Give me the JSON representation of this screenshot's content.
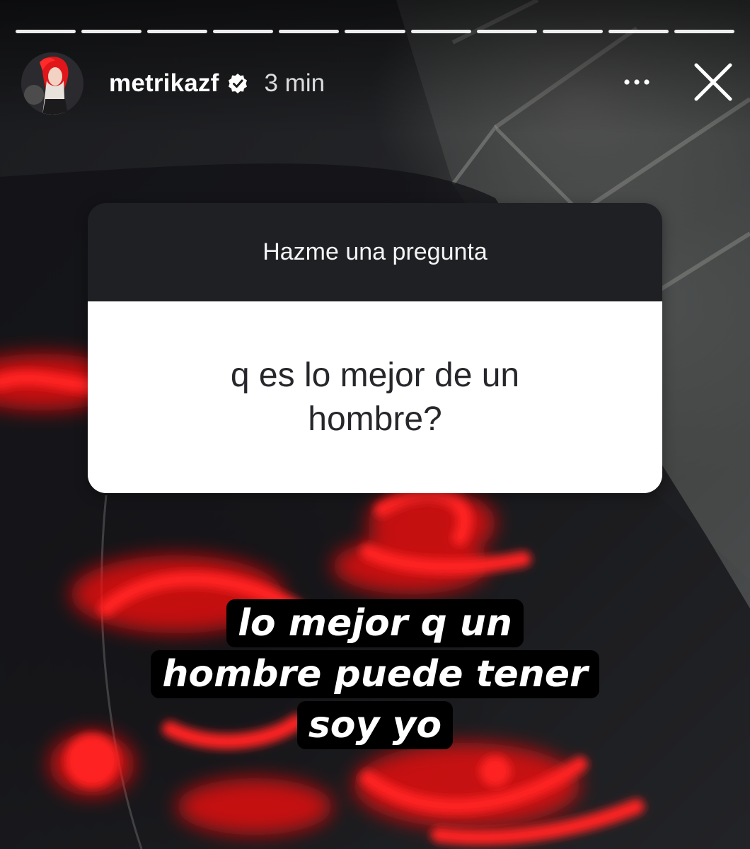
{
  "progress": {
    "segments": 11,
    "completed": 11
  },
  "header": {
    "username": "metrikazf",
    "verified": true,
    "time": "3 min",
    "avatar_icon": "avatar-red-hair",
    "more_icon": "more-horizontal-icon",
    "close_icon": "close-icon"
  },
  "question_sticker": {
    "title": "Hazme una pregunta",
    "question": "q es lo mejor de un hombre?"
  },
  "answer": {
    "lines": [
      "lo mejor q un",
      "hombre puede tener",
      "soy yo"
    ]
  },
  "colors": {
    "sticker_header": "#1e2024",
    "sticker_body": "#ffffff",
    "graffiti_red": "#ff1a1a",
    "caption_bg": "#000000"
  }
}
